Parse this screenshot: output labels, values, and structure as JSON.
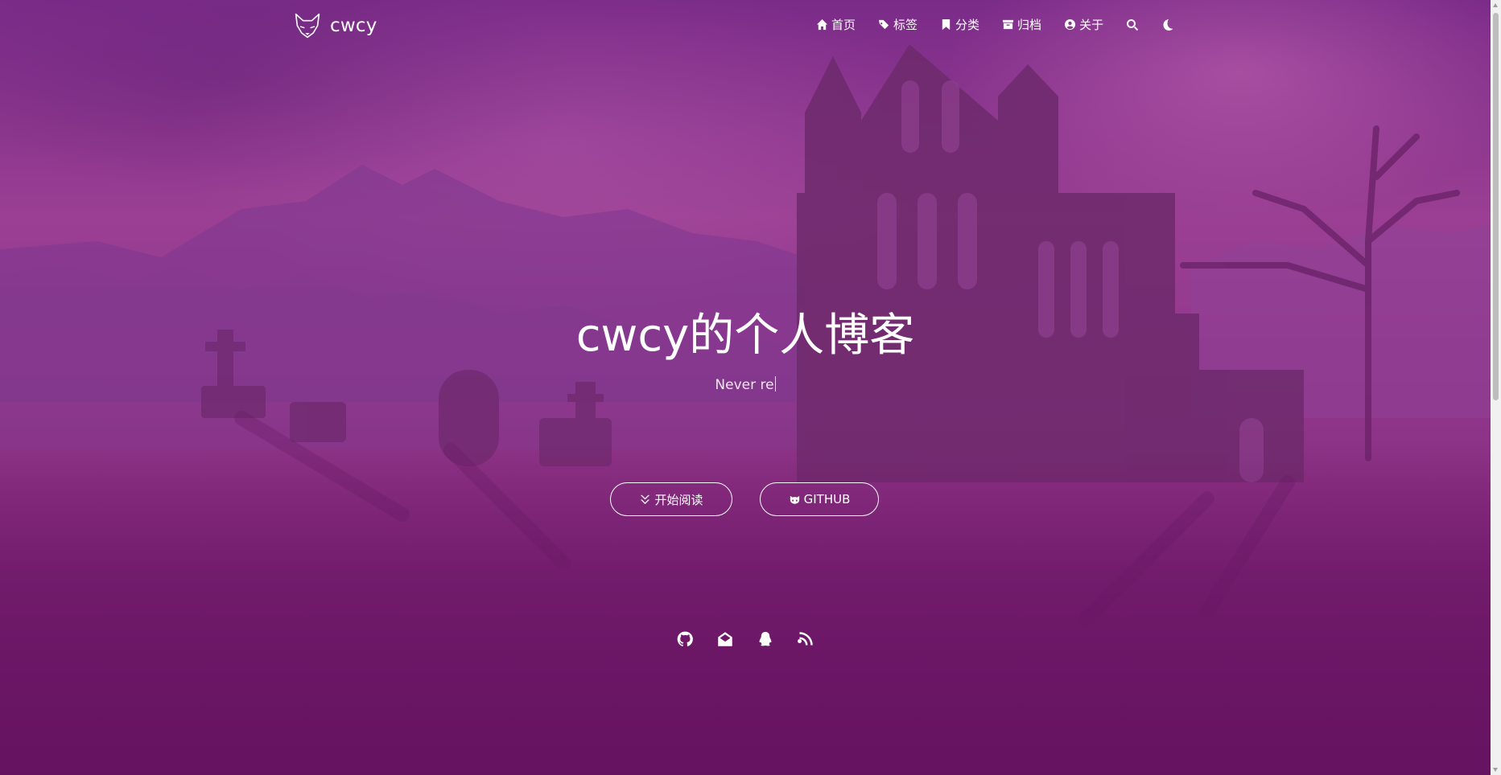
{
  "site": {
    "brand_name": "cwcy",
    "logo_icon": "fox-logo-icon"
  },
  "nav": {
    "items": [
      {
        "label": "首页",
        "icon": "home-icon"
      },
      {
        "label": "标签",
        "icon": "tags-icon"
      },
      {
        "label": "分类",
        "icon": "bookmark-icon"
      },
      {
        "label": "归档",
        "icon": "archive-icon"
      },
      {
        "label": "关于",
        "icon": "user-circle-icon"
      }
    ],
    "search_icon": "search-icon",
    "theme_icon": "moon-icon"
  },
  "hero": {
    "title": "cwcy的个人博客",
    "subtitle": "Never re",
    "buttons": {
      "read": {
        "label": "开始阅读",
        "icon": "double-chevron-down-icon"
      },
      "github": {
        "label": "GITHUB",
        "icon": "github-cat-icon"
      }
    }
  },
  "social": [
    {
      "icon": "github-icon"
    },
    {
      "icon": "email-icon"
    },
    {
      "icon": "qq-icon"
    },
    {
      "icon": "rss-icon"
    }
  ],
  "colors": {
    "overlay": "#8f3589",
    "text": "#ffffff"
  }
}
